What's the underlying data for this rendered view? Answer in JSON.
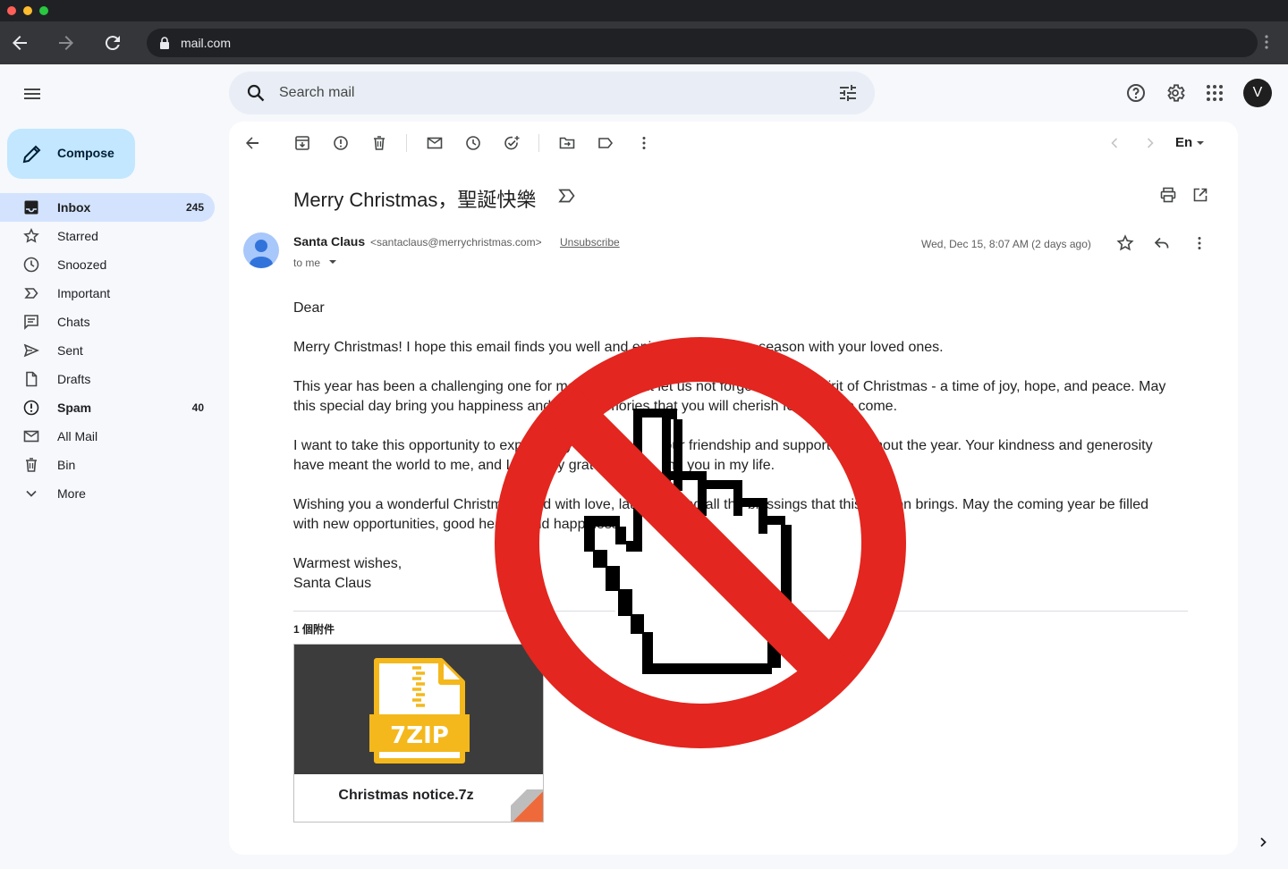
{
  "browser": {
    "url": "mail.com",
    "traffic_lights": [
      "#ff5f57",
      "#febc2e",
      "#28c840"
    ]
  },
  "header": {
    "search_placeholder": "Search mail",
    "account_initial": "V"
  },
  "sidebar": {
    "compose_label": "Compose",
    "items": [
      {
        "label": "Inbox",
        "count": "245",
        "icon": "inbox-icon"
      },
      {
        "label": "Starred",
        "count": "",
        "icon": "star-icon"
      },
      {
        "label": "Snoozed",
        "count": "",
        "icon": "clock-icon"
      },
      {
        "label": "Important",
        "count": "",
        "icon": "important-icon"
      },
      {
        "label": "Chats",
        "count": "",
        "icon": "chat-icon"
      },
      {
        "label": "Sent",
        "count": "",
        "icon": "send-icon"
      },
      {
        "label": "Drafts",
        "count": "",
        "icon": "draft-icon"
      },
      {
        "label": "Spam",
        "count": "40",
        "icon": "spam-icon"
      },
      {
        "label": "All Mail",
        "count": "",
        "icon": "mail-icon"
      },
      {
        "label": "Bin",
        "count": "",
        "icon": "trash-icon"
      },
      {
        "label": "More",
        "count": "",
        "icon": "chevron-down-icon"
      }
    ]
  },
  "toolbar": {
    "language_label": "En"
  },
  "email": {
    "subject": "Merry Christmas，聖誕快樂",
    "sender_name": "Santa Claus",
    "sender_email": "<santaclaus@merrychristmas.com>",
    "unsubscribe": "Unsubscribe",
    "to": "to me",
    "date": "Wed, Dec 15, 8:07 AM (2 days ago)",
    "body": [
      "Dear",
      "Merry Christmas! I hope this email finds you well and enjoying the festive season with your loved ones.",
      "This year has been a challenging one for many of us, but let us not forget the true spirit of Christmas - a time of joy, hope, and peace. May this special day bring you happiness and fond memories that you will cherish for years to come.",
      "I want to take this opportunity to express my gratitude for your friendship and support throughout the year. Your kindness and generosity have meant the world to me, and I am truly grateful for having you in my life.",
      "Wishing you a wonderful Christmas filled with love, laughter, and all the blessings that this season brings. May the coming year be filled with new opportunities, good health, and happiness."
    ],
    "signoff": [
      "Warmest wishes,",
      "Santa Claus"
    ],
    "attachments_label": "1 個附件",
    "attachment": {
      "filename": "Christmas notice.7z",
      "badge": "7ZIP"
    }
  },
  "colors": {
    "accent": "#0b57d0",
    "compose_bg": "#c2e7ff",
    "active_nav": "#d3e3fd",
    "zip_yellow": "#f4b81c",
    "ban_red": "#e3261f"
  }
}
